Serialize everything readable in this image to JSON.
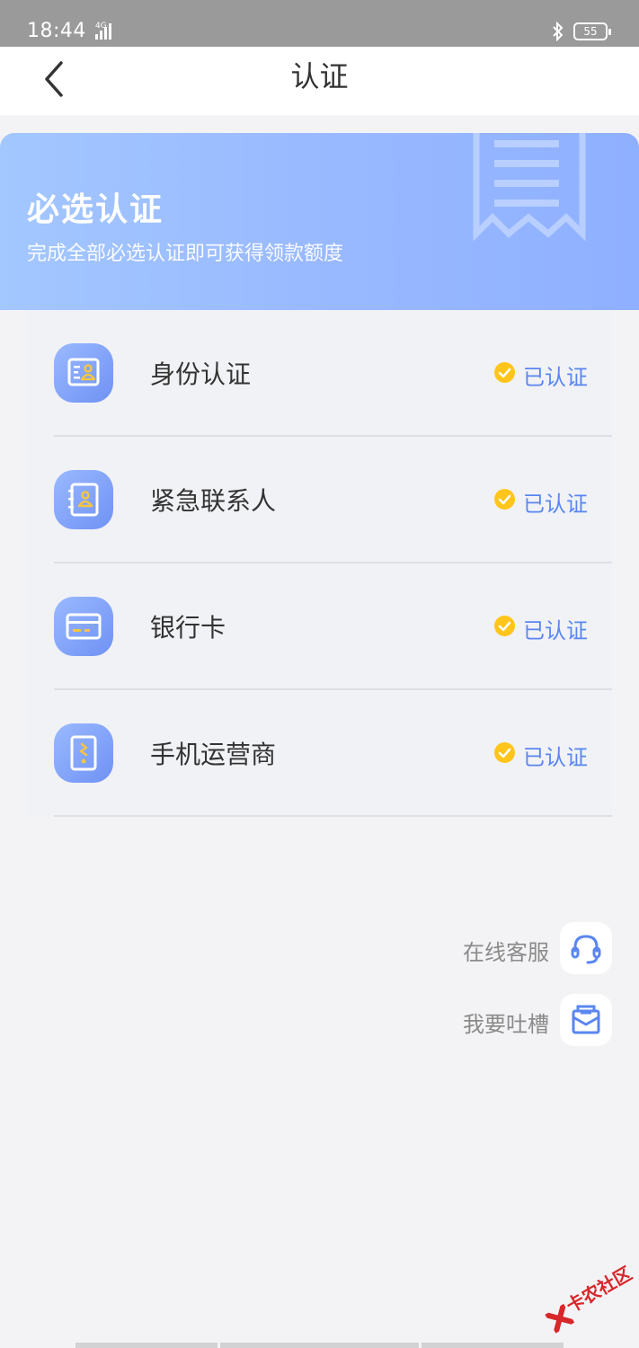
{
  "status_bar": {
    "time": "18:44",
    "network": "4G",
    "battery": "55"
  },
  "nav": {
    "title": "认证",
    "back_icon": "chevron-left-icon"
  },
  "banner": {
    "title": "必选认证",
    "subtitle": "完成全部必选认证即可获得领款额度",
    "gradient_start": "#a3c7ff",
    "gradient_end": "#8fb0ff"
  },
  "auth_items": [
    {
      "label": "身份认证",
      "status": "已认证",
      "icon": "id-card-icon"
    },
    {
      "label": "紧急联系人",
      "status": "已认证",
      "icon": "contact-book-icon"
    },
    {
      "label": "银行卡",
      "status": "已认证",
      "icon": "bank-card-icon"
    },
    {
      "label": "手机运营商",
      "status": "已认证",
      "icon": "phone-carrier-icon"
    }
  ],
  "service": {
    "online_label": "在线客服",
    "online_icon": "headset-icon",
    "feedback_label": "我要吐槽",
    "feedback_icon": "mail-icon"
  },
  "watermark": {
    "text": "卡农社区"
  },
  "colors": {
    "accent": "#5a86f0",
    "check": "#ffc51a",
    "icon_gold": "#f5c542"
  }
}
